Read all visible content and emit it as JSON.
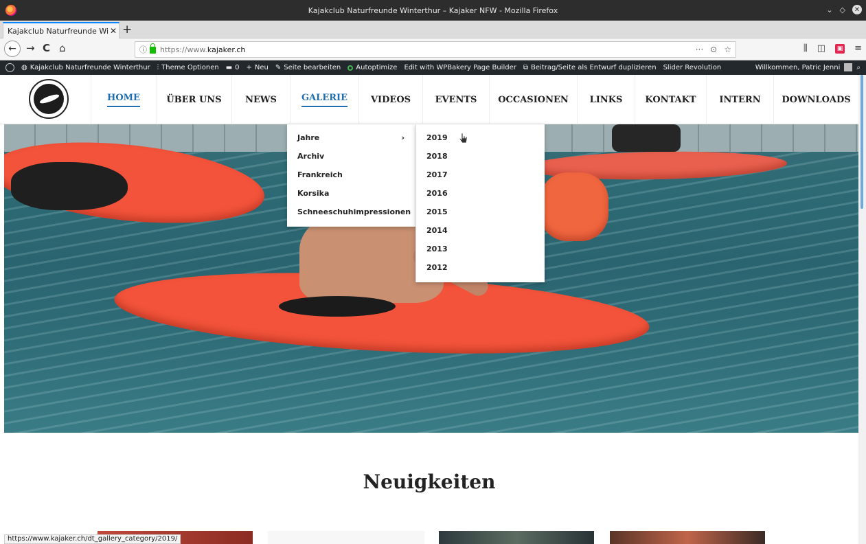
{
  "window": {
    "title": "Kajakclub Naturfreunde Winterthur – Kajaker NFW - Mozilla Firefox",
    "controls": [
      "minimize",
      "maximize",
      "close"
    ]
  },
  "tabs": [
    {
      "title": "Kajakclub Naturfreunde Winte",
      "close": "✕"
    }
  ],
  "newtab_label": "+",
  "navbar": {
    "back": "←",
    "forward": "→",
    "reload": "C",
    "home": "⌂",
    "url_proto": "https://www.",
    "url_host": "kajaker.ch",
    "url_actions": [
      "···",
      "⊙",
      "☆"
    ],
    "right_icons": [
      "library-icon",
      "sidebar-icon",
      "extension-icon",
      "menu-icon"
    ]
  },
  "wpbar": {
    "site": "Kajakclub Naturfreunde Winterthur",
    "theme": "Theme Optionen",
    "comments": "0",
    "new": "Neu",
    "edit": "Seite bearbeiten",
    "autoptimize": "Autoptimize",
    "wpbakery": "Edit with WPBakery Page Builder",
    "duplicate": "Beitrag/Seite als Entwurf duplizieren",
    "slider": "Slider Revolution",
    "welcome": "Willkommen, Patric Jenni"
  },
  "menu": [
    {
      "label": "HOME",
      "state": "active"
    },
    {
      "label": "ÜBER UNS",
      "state": ""
    },
    {
      "label": "NEWS",
      "state": ""
    },
    {
      "label": "GALERIE",
      "state": "hover"
    },
    {
      "label": "VIDEOS",
      "state": ""
    },
    {
      "label": "EVENTS",
      "state": ""
    },
    {
      "label": "OCCASIONEN",
      "state": ""
    },
    {
      "label": "LINKS",
      "state": ""
    },
    {
      "label": "KONTAKT",
      "state": ""
    },
    {
      "label": "INTERN",
      "state": ""
    },
    {
      "label": "DOWNLOADS",
      "state": ""
    }
  ],
  "galerie_dropdown": [
    {
      "label": "Jahre",
      "arrow": "›"
    },
    {
      "label": "Archiv"
    },
    {
      "label": "Frankreich"
    },
    {
      "label": "Korsika"
    },
    {
      "label": "Schneeschuhimpressionen"
    }
  ],
  "jahre_submenu": [
    "2019",
    "2018",
    "2017",
    "2016",
    "2015",
    "2014",
    "2013",
    "2012"
  ],
  "section_title": "Neuigkeiten",
  "status_url": "https://www.kajaker.ch/dt_gallery_category/2019/",
  "colors": {
    "accent": "#1f6fb0",
    "wp_admin_bar": "#23282d",
    "kayak": "#f2533a"
  }
}
